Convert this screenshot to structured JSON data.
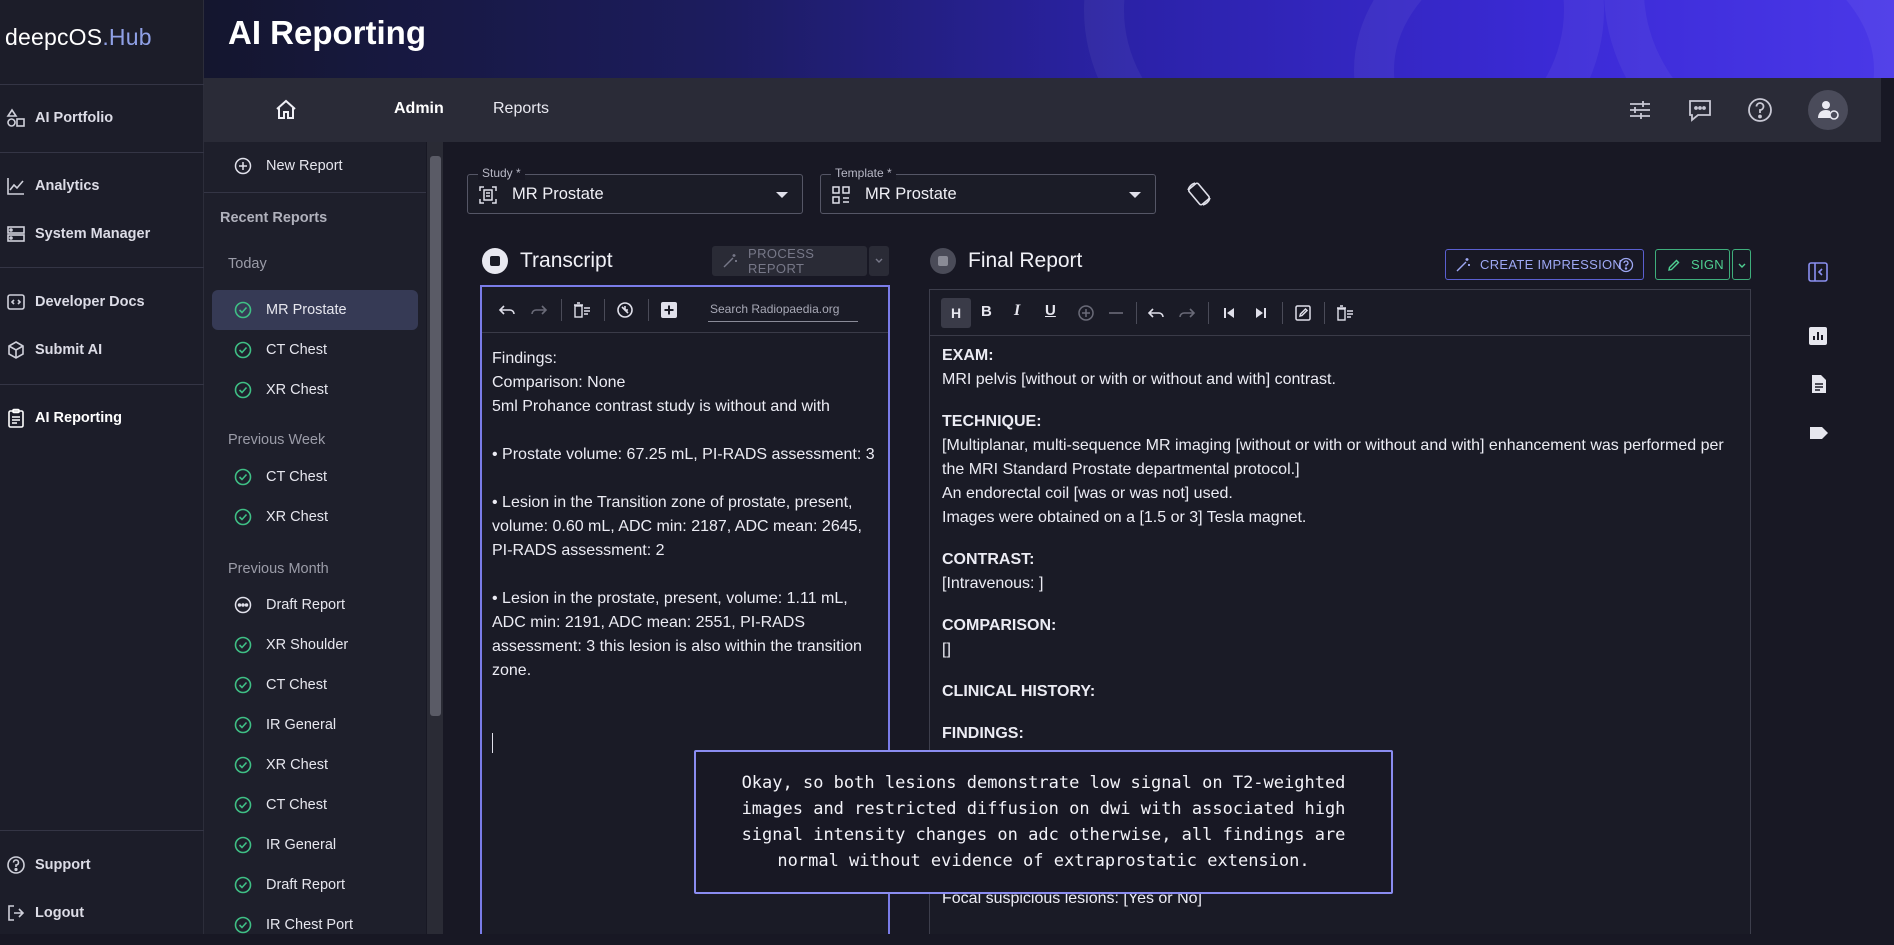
{
  "brand": {
    "name": "deepcOS",
    "suffix": ".Hub"
  },
  "header": {
    "title": "AI Reporting"
  },
  "sidebar": {
    "items": [
      {
        "label": "AI Portfolio",
        "icon": "shapes-icon"
      },
      {
        "label": "Analytics",
        "icon": "chart-line-icon"
      },
      {
        "label": "System Manager",
        "icon": "server-icon"
      },
      {
        "label": "Developer Docs",
        "icon": "code-icon"
      },
      {
        "label": "Submit AI",
        "icon": "cube-icon"
      },
      {
        "label": "AI Reporting",
        "icon": "clipboard-icon"
      }
    ],
    "footer": [
      {
        "label": "Support",
        "icon": "help-icon"
      },
      {
        "label": "Logout",
        "icon": "logout-icon"
      }
    ]
  },
  "topnav": {
    "home_icon": "home-icon",
    "links": [
      "Admin",
      "Reports"
    ],
    "right_icons": [
      "sliders-icon",
      "chat-icon",
      "help-icon",
      "user-settings-icon"
    ]
  },
  "reports_panel": {
    "new_report": "New Report",
    "recent_heading": "Recent Reports",
    "groups": [
      {
        "label": "Today",
        "items": [
          {
            "label": "MR Prostate",
            "status": "done",
            "active": true
          },
          {
            "label": "CT Chest",
            "status": "done"
          },
          {
            "label": "XR Chest",
            "status": "done"
          }
        ]
      },
      {
        "label": "Previous Week",
        "items": [
          {
            "label": "CT Chest",
            "status": "done"
          },
          {
            "label": "XR Chest",
            "status": "done"
          }
        ]
      },
      {
        "label": "Previous Month",
        "items": [
          {
            "label": "Draft Report",
            "status": "draft"
          },
          {
            "label": "XR Shoulder",
            "status": "done"
          },
          {
            "label": "CT Chest",
            "status": "done"
          },
          {
            "label": "IR General",
            "status": "done"
          },
          {
            "label": "XR Chest",
            "status": "done"
          },
          {
            "label": "CT Chest",
            "status": "done"
          },
          {
            "label": "IR General",
            "status": "done"
          },
          {
            "label": "Draft Report",
            "status": "done"
          },
          {
            "label": "IR Chest Port",
            "status": "done"
          }
        ]
      }
    ]
  },
  "study": {
    "label": "Study *",
    "value": "MR Prostate"
  },
  "template": {
    "label": "Template *",
    "value": "MR Prostate"
  },
  "transcript": {
    "title": "Transcript",
    "process_button": "PROCESS REPORT",
    "search_placeholder": "Search Radiopaedia.org",
    "text": "Findings:\nComparison: None\n5ml Prohance contrast study is without and with\n\n• Prostate volume: 67.25 mL, PI-RADS assessment: 3\n\n• Lesion in the Transition zone of prostate, present, volume: 0.60 mL, ADC min: 2187, ADC mean: 2645, PI-RADS assessment: 2\n\n• Lesion in the prostate, present, volume: 1.11 mL, ADC min: 2191, ADC mean: 2551, PI-RADS assessment: 3 this lesion is also within the transition zone."
  },
  "final_report": {
    "title": "Final Report",
    "impression_button": "CREATE IMPRESSION",
    "sign_button": "SIGN",
    "heading_button": "H",
    "sections": [
      {
        "heading": "EXAM:",
        "lines": [
          "MRI pelvis [without or with or without and with] contrast."
        ]
      },
      {
        "heading": "TECHNIQUE:",
        "lines": [
          "[Multiplanar, multi-sequence MR imaging  [without or with or without and with]  enhancement was performed per the MRI Standard Prostate departmental protocol.]",
          "An endorectal coil [was or was not] used.",
          "Images were obtained on a [1.5 or 3] Tesla magnet."
        ]
      },
      {
        "heading": "CONTRAST:",
        "lines": [
          "[Intravenous: ]"
        ]
      },
      {
        "heading": "COMPARISON:",
        "lines": [
          "[]"
        ]
      },
      {
        "heading": "CLINICAL HISTORY:",
        "lines": []
      },
      {
        "heading": "FINDINGS:",
        "lines": []
      }
    ],
    "trailing_line": "Focal suspicious lesions: [Yes or No]"
  },
  "dictation_tooltip": "Okay, so both lesions demonstrate low signal on T2-weighted images and restricted diffusion on dwi with associated high signal intensity changes on adc otherwise, all findings are normal without evidence of extraprostatic extension.",
  "right_rail_icons": [
    "collapse-panel-icon",
    "bar-chart-icon",
    "document-icon",
    "tag-icon"
  ]
}
